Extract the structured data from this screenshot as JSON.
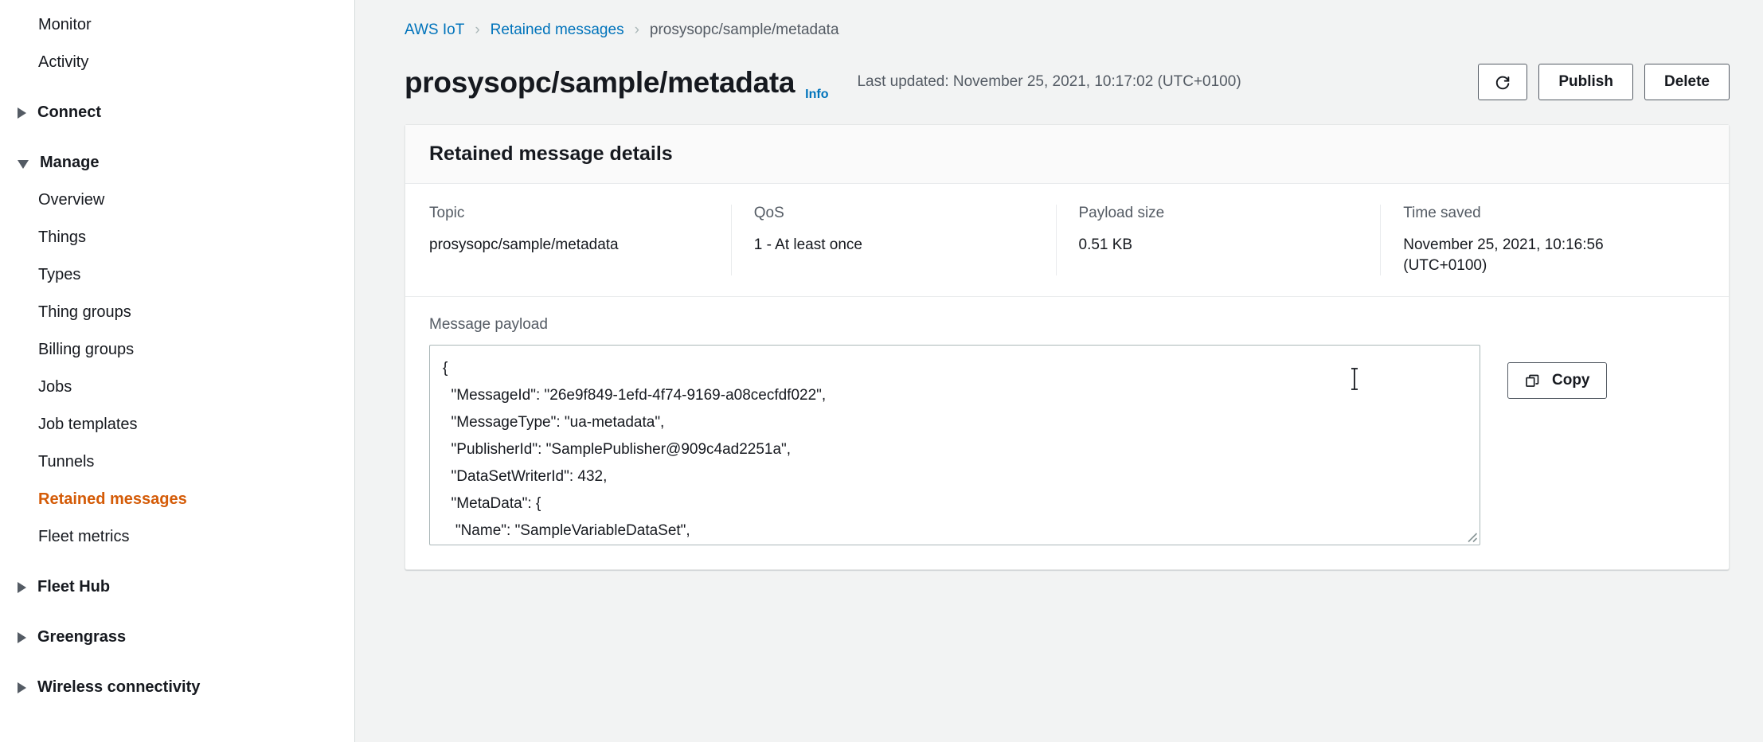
{
  "sidebar": {
    "items": [
      {
        "label": "Monitor",
        "type": "child",
        "active": false
      },
      {
        "label": "Activity",
        "type": "child",
        "active": false
      },
      {
        "label": "Connect",
        "type": "group",
        "expanded": false,
        "active": false
      },
      {
        "label": "Manage",
        "type": "group",
        "expanded": true,
        "active": false
      },
      {
        "label": "Overview",
        "type": "child",
        "active": false
      },
      {
        "label": "Things",
        "type": "child",
        "active": false
      },
      {
        "label": "Types",
        "type": "child",
        "active": false
      },
      {
        "label": "Thing groups",
        "type": "child",
        "active": false
      },
      {
        "label": "Billing groups",
        "type": "child",
        "active": false
      },
      {
        "label": "Jobs",
        "type": "child",
        "active": false
      },
      {
        "label": "Job templates",
        "type": "child",
        "active": false
      },
      {
        "label": "Tunnels",
        "type": "child",
        "active": false
      },
      {
        "label": "Retained messages",
        "type": "child",
        "active": true
      },
      {
        "label": "Fleet metrics",
        "type": "child",
        "active": false
      },
      {
        "label": "Fleet Hub",
        "type": "group",
        "expanded": false,
        "active": false
      },
      {
        "label": "Greengrass",
        "type": "group",
        "expanded": false,
        "active": false
      },
      {
        "label": "Wireless connectivity",
        "type": "group",
        "expanded": false,
        "active": false
      }
    ]
  },
  "breadcrumb": {
    "root": "AWS IoT",
    "section": "Retained messages",
    "current": "prosysopc/sample/metadata",
    "separator": "›"
  },
  "header": {
    "title": "prosysopc/sample/metadata",
    "info_label": "Info",
    "last_updated": "Last updated: November 25, 2021, 10:17:02 (UTC+0100)",
    "refresh_label": "↻",
    "publish_label": "Publish",
    "delete_label": "Delete"
  },
  "details": {
    "heading": "Retained message details",
    "fields": [
      {
        "label": "Topic",
        "value": "prosysopc/sample/metadata"
      },
      {
        "label": "QoS",
        "value": "1 - At least once"
      },
      {
        "label": "Payload size",
        "value": "0.51 KB"
      },
      {
        "label": "Time saved",
        "value": "November 25, 2021, 10:16:56 (UTC+0100)"
      }
    ],
    "payload_label": "Message payload",
    "payload": "{\n  \"MessageId\": \"26e9f849-1efd-4f74-9169-a08cecfdf022\",\n  \"MessageType\": \"ua-metadata\",\n  \"PublisherId\": \"SamplePublisher@909c4ad2251a\",\n  \"DataSetWriterId\": 432,\n  \"MetaData\": {\n   \"Name\": \"SampleVariableDataSet\",\n   \"Fields\": [\n    {\n     \"Name\": \"MyLevel\",",
    "copy_label": "Copy"
  },
  "colors": {
    "accent": "#d45b07",
    "link": "#0073bb",
    "text": "#16191f",
    "muted": "#545b64",
    "page_bg": "#f2f3f3",
    "border": "#aab7b8"
  }
}
